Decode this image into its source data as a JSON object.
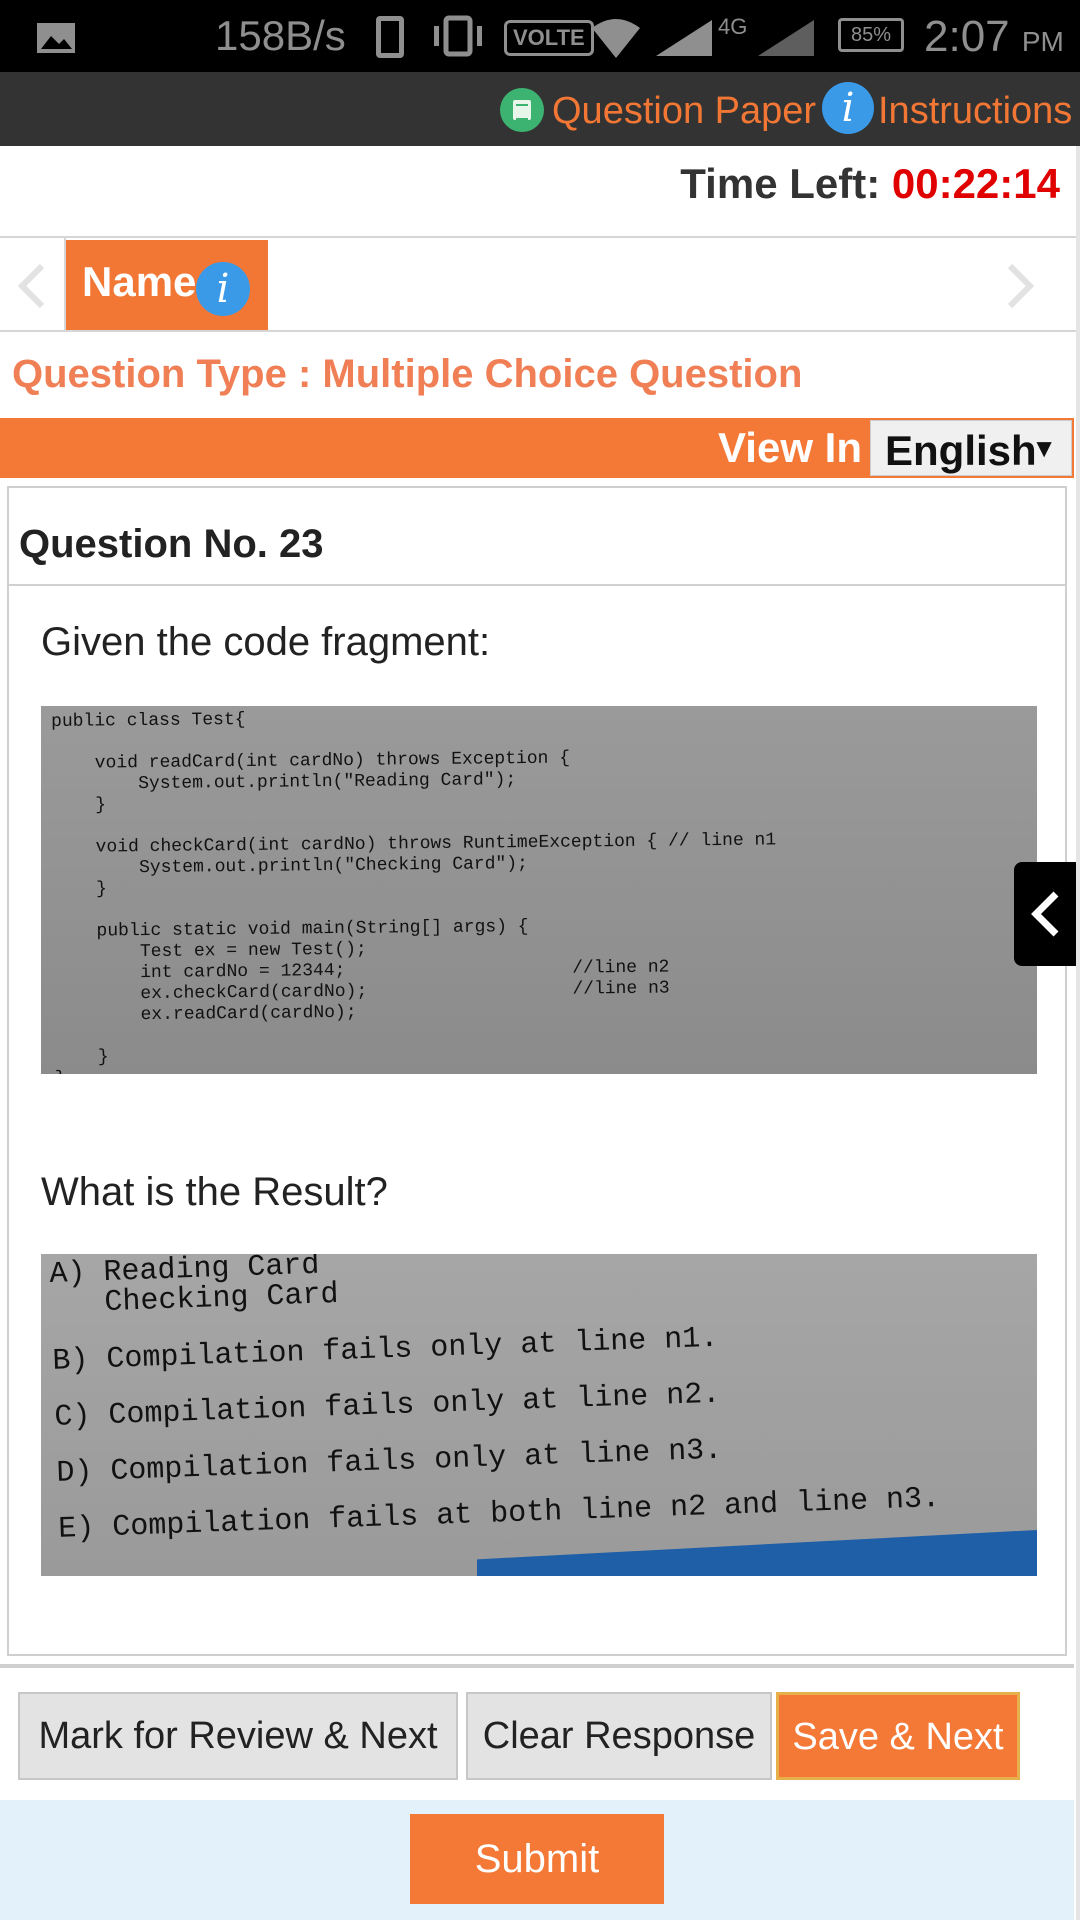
{
  "status_bar": {
    "net_speed": "158B/s",
    "volte": "VOLTE",
    "network": "4G",
    "battery": "85%",
    "time": "2:07",
    "ampm": "PM"
  },
  "top_nav": {
    "question_paper": "Question Paper",
    "instructions": "Instructions"
  },
  "timer": {
    "label": "Time Left: ",
    "value": "00:22:14"
  },
  "section": {
    "name_tab": "Name",
    "info_glyph": "i"
  },
  "question_type": "Question Type : Multiple Choice Question",
  "language": {
    "view_in": "View In",
    "selected": "English",
    "caret": "▼"
  },
  "question": {
    "number": "Question No. 23",
    "intro": "Given the code fragment:",
    "code_lines": [
      "public class Test{",
      "",
      "    void readCard(int cardNo) throws Exception {",
      "        System.out.println(\"Reading Card\");",
      "    }",
      "",
      "    void checkCard(int cardNo) throws RuntimeException { // line n1",
      "        System.out.println(\"Checking Card\");",
      "    }",
      "",
      "    public static void main(String[] args) {",
      "        Test ex = new Test();",
      "        int cardNo = 12344;                     //line n2",
      "        ex.checkCard(cardNo);                   //line n3",
      "        ex.readCard(cardNo);",
      "",
      "    }",
      "}"
    ],
    "prompt": "What is the Result?",
    "options": [
      "A) Reading Card\n   Checking Card",
      "B) Compilation fails only at line n1.",
      "C) Compilation fails only at line n2.",
      "D) Compilation fails only at line n3.",
      "E) Compilation fails at both line n2 and line n3."
    ]
  },
  "actions": {
    "mark_review": "Mark for Review & Next",
    "clear": "Clear Response",
    "save_next": "Save & Next",
    "submit": "Submit"
  },
  "colors": {
    "accent": "#f47836",
    "timer": "#e00000",
    "info_blue": "#3a9ae8",
    "nav_bg": "#333333"
  },
  "icons": [
    "gallery-icon",
    "phone-icon",
    "vibrate-icon",
    "wifi-icon",
    "signal-icon",
    "question-paper-icon",
    "info-icon",
    "chevron-left-icon",
    "chevron-right-icon"
  ]
}
